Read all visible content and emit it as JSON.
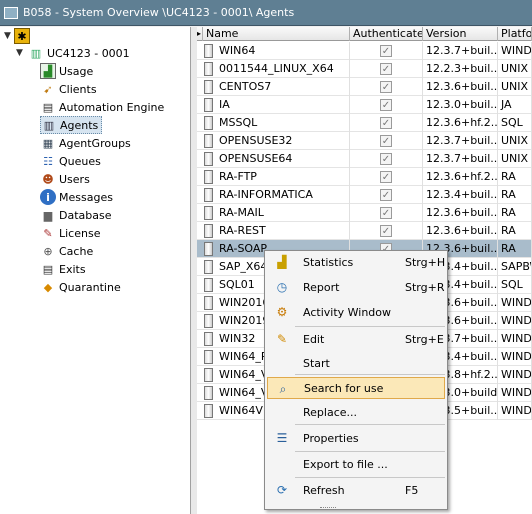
{
  "window": {
    "title": "B058 - System Overview \\UC4123 - 0001\\ Agents"
  },
  "tree": {
    "root": "UC4123 - 0001",
    "items": [
      {
        "label": "Usage",
        "icon": "chart-icon"
      },
      {
        "label": "Clients",
        "icon": "clients-icon"
      },
      {
        "label": "Automation Engine",
        "icon": "server-icon"
      },
      {
        "label": "Agents",
        "icon": "agents-icon"
      },
      {
        "label": "AgentGroups",
        "icon": "agentgroups-icon"
      },
      {
        "label": "Queues",
        "icon": "queues-icon"
      },
      {
        "label": "Users",
        "icon": "users-icon"
      },
      {
        "label": "Messages",
        "icon": "info-icon"
      },
      {
        "label": "Database",
        "icon": "database-icon"
      },
      {
        "label": "License",
        "icon": "license-icon"
      },
      {
        "label": "Cache",
        "icon": "cache-icon"
      },
      {
        "label": "Exits",
        "icon": "exits-icon"
      },
      {
        "label": "Quarantine",
        "icon": "warning-icon"
      }
    ]
  },
  "table": {
    "columns": [
      "Name",
      "Authenticated",
      "Version",
      "Platfor"
    ],
    "rows": [
      {
        "name": "WIN64",
        "version": "12.3.7+buil...",
        "platform": "WINDO"
      },
      {
        "name": "0011544_LINUX_X64",
        "version": "12.2.3+buil...",
        "platform": "UNIX"
      },
      {
        "name": "CENTOS7",
        "version": "12.3.6+buil...",
        "platform": "UNIX"
      },
      {
        "name": "IA",
        "version": "12.3.0+buil...",
        "platform": "JA"
      },
      {
        "name": "MSSQL",
        "version": "12.3.6+hf.2...",
        "platform": "SQL"
      },
      {
        "name": "OPENSUSE32",
        "version": "12.3.7+buil...",
        "platform": "UNIX"
      },
      {
        "name": "OPENSUSE64",
        "version": "12.3.7+buil...",
        "platform": "UNIX"
      },
      {
        "name": "RA-FTP",
        "version": "12.3.6+hf.2...",
        "platform": "RA"
      },
      {
        "name": "RA-INFORMATICA",
        "version": "12.3.4+buil...",
        "platform": "RA"
      },
      {
        "name": "RA-MAIL",
        "version": "12.3.6+buil...",
        "platform": "RA"
      },
      {
        "name": "RA-REST",
        "version": "12.3.6+buil...",
        "platform": "RA"
      },
      {
        "name": "RA-SOAP",
        "version": "12.3.6+buil...",
        "platform": "RA"
      },
      {
        "name": "SAP_X64",
        "version": "12.3.4+buil...",
        "platform": "SAPBW"
      },
      {
        "name": "SQL01",
        "version": "12.3.4+buil...",
        "platform": "SQL"
      },
      {
        "name": "WIN2016",
        "version": "12.3.6+buil...",
        "platform": "WINDO"
      },
      {
        "name": "WIN2019",
        "version": "12.3.6+buil...",
        "platform": "WINDO"
      },
      {
        "name": "WIN32",
        "version": "12.3.7+buil...",
        "platform": "WINDO"
      },
      {
        "name": "WIN64_P",
        "version": "12.3.4+buil...",
        "platform": "WINDO"
      },
      {
        "name": "WIN64_V",
        "version": "12.3.8+hf.2...",
        "platform": "WINDO"
      },
      {
        "name": "WIN64_V",
        "version": "12.3.0+build...",
        "platform": "WINDO"
      },
      {
        "name": "WIN64V1",
        "version": "12.3.5+buil...",
        "platform": "WINDO"
      }
    ]
  },
  "context_menu": {
    "items": [
      {
        "label": "Statistics",
        "shortcut": "Strg+H",
        "icon": "statistics-icon"
      },
      {
        "label": "Report",
        "shortcut": "Strg+R",
        "icon": "report-icon"
      },
      {
        "label": "Activity Window",
        "shortcut": "",
        "icon": "activity-window-icon"
      },
      {
        "label": "Edit",
        "shortcut": "Strg+E",
        "icon": "edit-icon"
      },
      {
        "label": "Start",
        "shortcut": "",
        "icon": ""
      },
      {
        "label": "Search for use",
        "shortcut": "",
        "icon": "search-icon"
      },
      {
        "label": "Replace...",
        "shortcut": "",
        "icon": ""
      },
      {
        "label": "Properties",
        "shortcut": "",
        "icon": "properties-icon"
      },
      {
        "label": "Export to file ...",
        "shortcut": "",
        "icon": ""
      },
      {
        "label": "Refresh",
        "shortcut": "F5",
        "icon": "refresh-icon"
      }
    ]
  },
  "colors": {
    "titlebar": "#5f7f93",
    "selected_row": "#a9bccb",
    "menu_highlight": "#fbe8b8"
  }
}
